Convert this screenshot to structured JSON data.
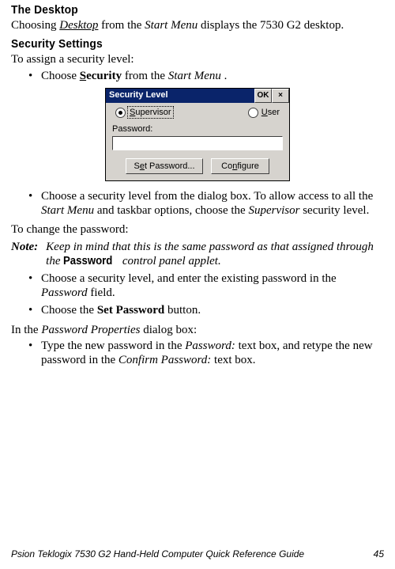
{
  "section1": {
    "title": "The Desktop",
    "para_before": "Choosing ",
    "key": "Desktop",
    "para_mid": " from the ",
    "startmenu": "Start Menu",
    "para_after": " displays the 7530 G2 desktop."
  },
  "section2": {
    "title": "Security Settings",
    "intro": "To assign a security level:",
    "bullet1_a": "Choose ",
    "bullet1_key": "Security",
    "bullet1_b": " from the ",
    "startmenu": "Start Menu",
    "bullet1_c": "."
  },
  "dialog": {
    "title": "Security Level",
    "ok": "OK",
    "close": "×",
    "supervisor": "Supervisor",
    "user": "User",
    "password_label": "Password:",
    "set_password_btn": "Set Password...",
    "configure_btn": "Configure"
  },
  "after_dialog": {
    "bullet1_a": "Choose a security level from the dialog box. To allow access to all the ",
    "startmenu": "Start Menu",
    "bullet1_b": " and taskbar options, choose the ",
    "supervisor": "Supervisor",
    "bullet1_c": " security level.",
    "change_intro": "To change the password:"
  },
  "note": {
    "label": "Note:",
    "body_a": "Keep in mind that this is the same password as that assigned through the ",
    "password_word": "Password",
    "body_b": " control panel applet."
  },
  "bullets2": {
    "b1_a": "Choose a security level, and enter the existing password in the ",
    "b1_field": "Password",
    "b1_b": " field.",
    "b2_a": "Choose the ",
    "b2_btn": "Set Password",
    "b2_b": " button."
  },
  "in_dialog": {
    "line_a": "In the ",
    "pp": "Password Properties",
    "line_b": " dialog box:"
  },
  "bullets3": {
    "b1_a": "Type the new password in the ",
    "pw": "Password:",
    "b1_b": " text box, and retype the new password in the ",
    "cpw": "Confirm Password:",
    "b1_c": " text box."
  },
  "footer": {
    "left": "Psion Teklogix 7530 G2 Hand-Held Computer Quick Reference Guide",
    "right": "45"
  }
}
